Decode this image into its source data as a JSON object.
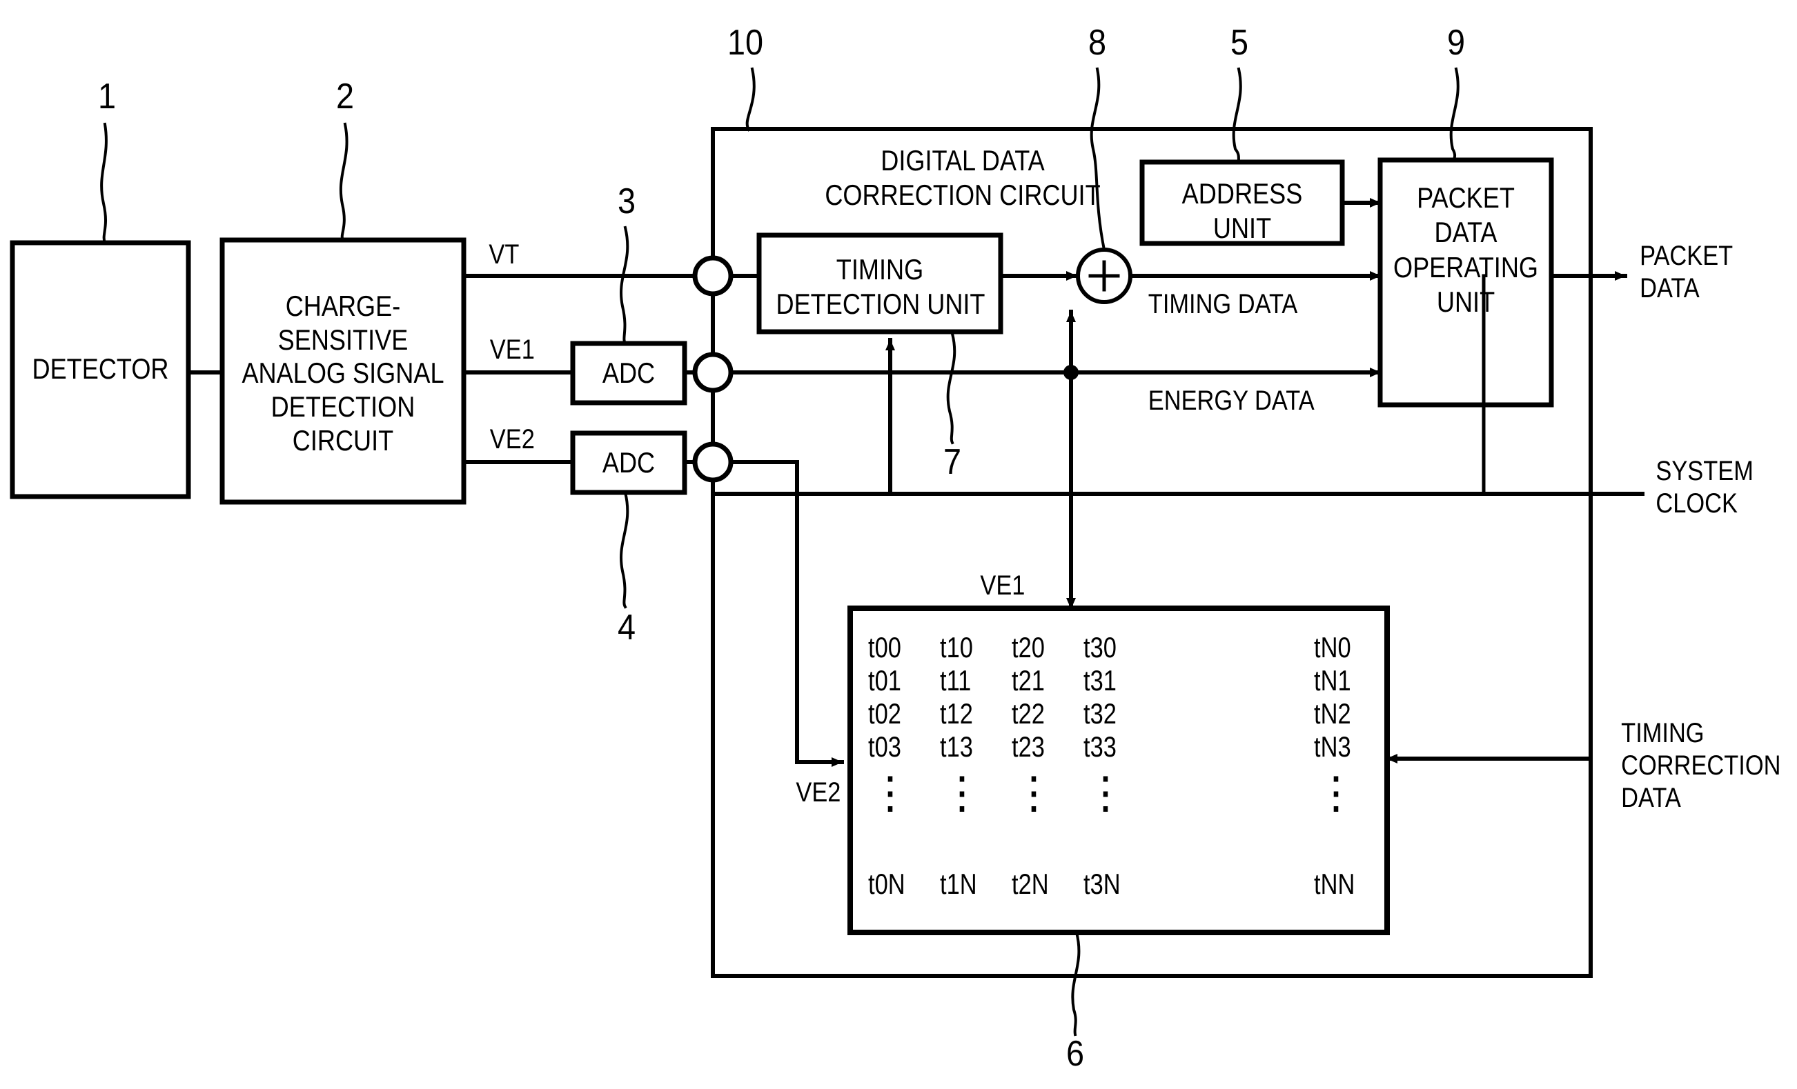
{
  "figure": {
    "title": "Digital data correction circuit block diagram",
    "blocks": {
      "detector": {
        "label": "DETECTOR",
        "ref": "1"
      },
      "charge_sensitive": {
        "label": "CHARGE-\nSENSITIVE\nANALOG SIGNAL\nDETECTION\nCIRCUIT",
        "ref": "2"
      },
      "adc1": {
        "label": "ADC",
        "ref": "3"
      },
      "adc2": {
        "label": "ADC",
        "ref": "4"
      },
      "digital_correction": {
        "label": "DIGITAL DATA\nCORRECTION CIRCUIT",
        "ref": "10"
      },
      "timing_detection": {
        "label": "TIMING\nDETECTION UNIT",
        "ref": "7"
      },
      "adder": {
        "label": "+",
        "ref": "8"
      },
      "address_unit": {
        "label": "ADDRESS\nUNIT",
        "ref": "5"
      },
      "packet_data_operating": {
        "label": "PACKET\nDATA\nOPERATING\nUNIT",
        "ref": "9"
      },
      "lookup_table": {
        "ref": "6"
      }
    },
    "signal_labels": {
      "vt": "VT",
      "ve1": "VE1",
      "ve2": "VE2",
      "ve1_table": "VE1",
      "ve2_table": "VE2",
      "timing_data": "TIMING DATA",
      "energy_data": "ENERGY DATA",
      "system_clock": "SYSTEM\nCLOCK",
      "packet_data_out": "PACKET\nDATA",
      "timing_correction_data": "TIMING\nCORRECTION\nDATA"
    },
    "lookup_table_cells": {
      "rows": [
        [
          "t00",
          "t10",
          "t20",
          "t30",
          "tN0"
        ],
        [
          "t01",
          "t11",
          "t21",
          "t31",
          "tN1"
        ],
        [
          "t02",
          "t12",
          "t22",
          "t32",
          "tN2"
        ],
        [
          "t03",
          "t13",
          "t23",
          "t33",
          "tN3"
        ],
        [
          "t0N",
          "t1N",
          "t2N",
          "t3N",
          "tNN"
        ]
      ],
      "ellipsis": "⋮"
    },
    "reference_numerals": [
      "1",
      "2",
      "3",
      "4",
      "5",
      "6",
      "7",
      "8",
      "9",
      "10"
    ],
    "colors": {
      "line": "#000000",
      "background": "#ffffff"
    }
  }
}
